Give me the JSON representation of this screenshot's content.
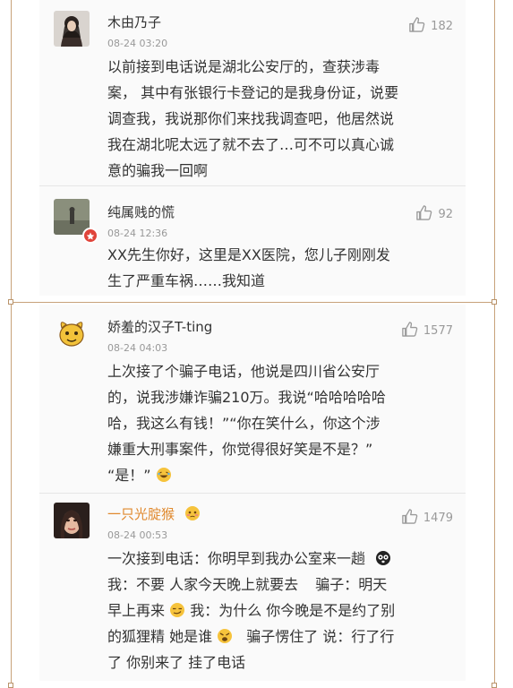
{
  "comments": [
    {
      "username": "木由乃子",
      "time": "08-24 03:20",
      "likes": "182",
      "text": "以前接到电话说是湖北公安厅的，查获涉毒案，其中有张银行卡登记的是我身份证，说要调查我，我说那你们来找我调查吧，他居然说我在湖北呢太远了就不去了…可不可以真心诚意的骗我一回啊",
      "lines": [
        "以前接到电话说是湖北公安厅的，查获涉毒",
        "案， 其中有张银行卡登记的是我身份证，说要",
        "调查我，我说那你们来找我调查吧，他居然说",
        "我在湖北呢太远了就不去了…可不可以真心诚",
        "意的骗我一回啊"
      ]
    },
    {
      "username": "纯属贱的慌",
      "time": "08-24 12:36",
      "likes": "92",
      "lines": [
        "XX先生你好，这里是XX医院，您儿子刚刚发",
        "生了严重车祸……我知道"
      ]
    },
    {
      "username": "娇羞的汉子T-ting",
      "time": "08-24 04:03",
      "likes": "1577",
      "lines": [
        "上次接了个骗子电话，他说是四川省公安厅",
        "的，说我涉嫌诈骗210万。我说“哈哈哈哈哈",
        "哈，我这么有钱！”“你在笑什么，你这个涉",
        "嫌重大刑事案件，你觉得很好笑是不是？”",
        "“是！”"
      ]
    },
    {
      "username": "一只光腚猴",
      "time": "08-24 00:53",
      "likes": "1479",
      "lines": [
        "一次接到电话：你明早到我办公室来一趟",
        "我：不要 人家今天晚上就要去",
        "骗子：明天",
        "早上再来",
        "我：为什么 你今晚是不是约了别",
        "的狐狸精 她是谁",
        "骗子愣住了 说：行了行",
        "了 你别来了 挂了电话"
      ]
    }
  ],
  "icons": {
    "like": "thumbs-up-icon",
    "vip_badge": "verified-badge-icon"
  },
  "colors": {
    "username_orange": "#e0892e",
    "text": "#333333",
    "meta": "#999999",
    "frame": "#c8a27a"
  }
}
